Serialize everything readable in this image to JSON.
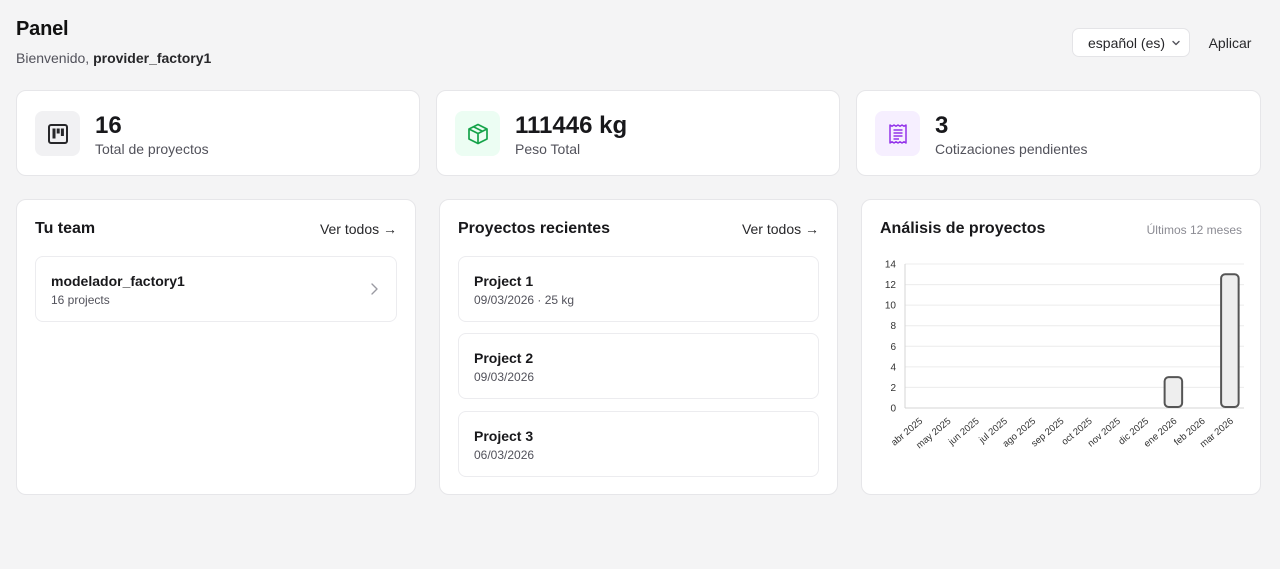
{
  "header": {
    "title": "Panel",
    "welcome_prefix": "Bienvenido, ",
    "username": "provider_factory1"
  },
  "controls": {
    "language_selected": "español (es)",
    "apply_label": "Aplicar"
  },
  "stats": [
    {
      "value": "16",
      "label": "Total de proyectos",
      "icon": "board-icon",
      "icon_color": "#27272a",
      "icon_bg": "#f1f1f3"
    },
    {
      "value": "111446 kg",
      "label": "Peso Total",
      "icon": "box-icon",
      "icon_color": "#16a34a",
      "icon_bg": "#ecfdf3"
    },
    {
      "value": "3",
      "label": "Cotizaciones pendientes",
      "icon": "receipt-icon",
      "icon_color": "#9333ea",
      "icon_bg": "#f6efff"
    }
  ],
  "team": {
    "title": "Tu team",
    "view_all": "Ver todos →",
    "members": [
      {
        "name": "modelador_factory1",
        "projects": "16 projects"
      }
    ]
  },
  "recent": {
    "title": "Proyectos recientes",
    "view_all": "Ver todos →",
    "projects": [
      {
        "name": "Project 1",
        "meta": "09/03/2026 · 25 kg"
      },
      {
        "name": "Project 2",
        "meta": "09/03/2026"
      },
      {
        "name": "Project 3",
        "meta": "06/03/2026"
      }
    ]
  },
  "analysis": {
    "title": "Análisis de proyectos",
    "range": "Últimos 12 meses"
  },
  "chart_data": {
    "type": "bar",
    "categories": [
      "abr 2025",
      "may 2025",
      "jun 2025",
      "jul 2025",
      "ago 2025",
      "sep 2025",
      "oct 2025",
      "nov 2025",
      "dic 2025",
      "ene 2026",
      "feb 2026",
      "mar 2026"
    ],
    "values": [
      0,
      0,
      0,
      0,
      0,
      0,
      0,
      0,
      0,
      3,
      0,
      13
    ],
    "ylim": [
      0,
      14
    ],
    "yticks": [
      0,
      2,
      4,
      6,
      8,
      10,
      12,
      14
    ],
    "grid": true,
    "bar_fill": "#eeeeee",
    "bar_stroke": "#555555"
  }
}
